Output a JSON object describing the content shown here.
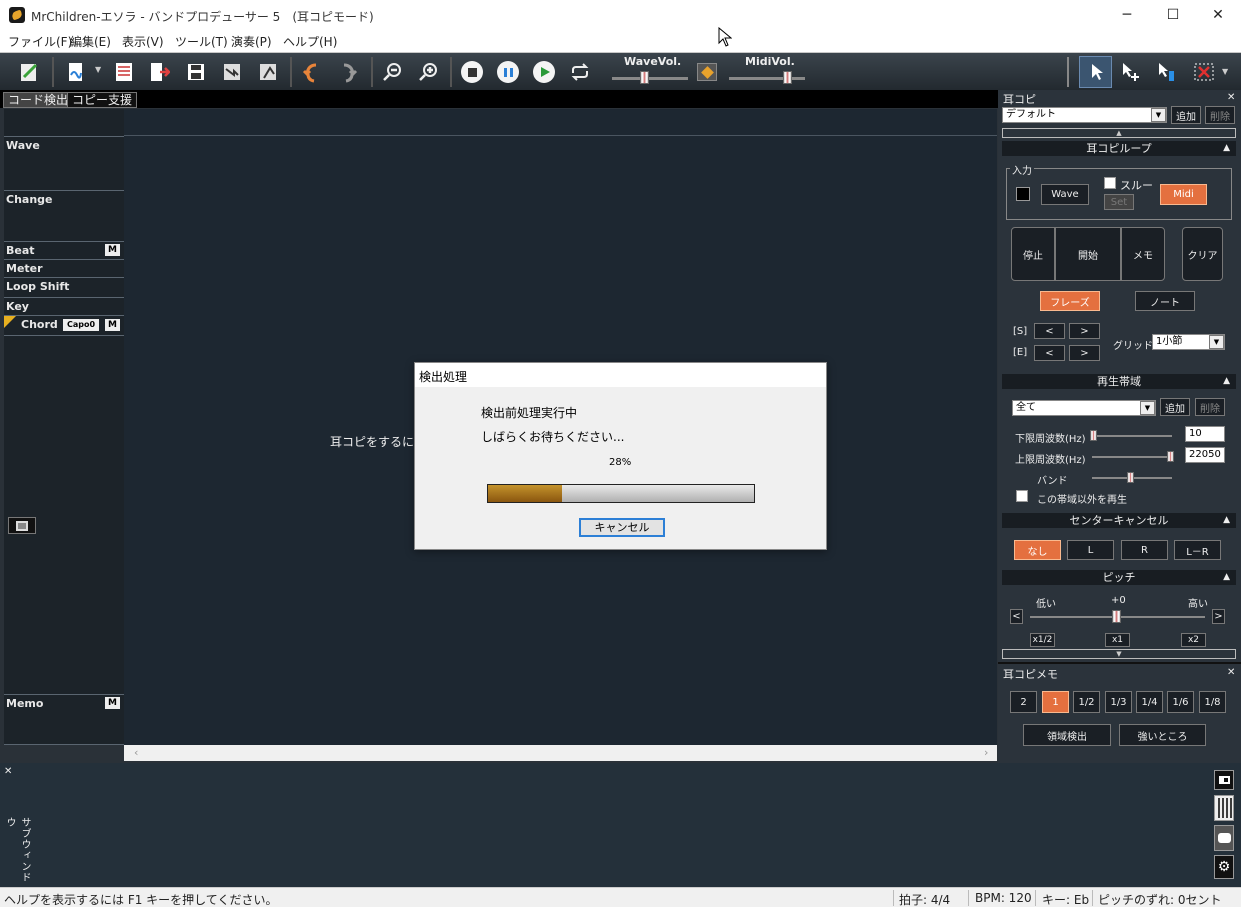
{
  "window": {
    "title": "MrChildren-エソラ - バンドプロデューサー 5　(耳コピモード)"
  },
  "menu": [
    "ファイル(F)",
    "編集(E)",
    "表示(V)",
    "ツール(T)",
    "演奏(P)",
    "ヘルプ(H)"
  ],
  "toolbar": {
    "wave_vol_label": "WaveVol.",
    "midi_vol_label": "MidiVol."
  },
  "tabs": [
    "コード検出",
    "コピー支援"
  ],
  "tracks": {
    "wave": "Wave",
    "change": "Change",
    "beat": "Beat",
    "meter": "Meter",
    "loop_shift": "Loop Shift",
    "key": "Key",
    "chord": "Chord",
    "capo": "Capo0",
    "memo": "Memo",
    "m": "M"
  },
  "canvas": {
    "hint_text": "耳コピをするにはメ"
  },
  "dialog": {
    "title": "検出処理",
    "line1": "検出前処理実行中",
    "line2": "しばらくお待ちください...",
    "percent_text": "28%",
    "progress": 0.28,
    "cancel": "キャンセル"
  },
  "right": {
    "panel_title": "耳コピ",
    "preset_select": "デフォルト",
    "add": "追加",
    "delete": "削除",
    "loop_section": "耳コピループ",
    "input_group": "入力",
    "wave_btn": "Wave",
    "through": "スルー",
    "set": "Set",
    "midi_btn": "Midi",
    "stop": "停止",
    "start": "開始",
    "memo": "メモ",
    "clear": "クリア",
    "phrase": "フレーズ",
    "note": "ノート",
    "s_label": "[S]",
    "e_label": "[E]",
    "lt": "<",
    "gt": ">",
    "grid_label": "グリッド",
    "grid_value": "1小節",
    "band_section": "再生帯域",
    "band_select": "全て",
    "low_freq_label": "下限周波数(Hz)",
    "low_freq_value": "10",
    "high_freq_label": "上限周波数(Hz)",
    "high_freq_value": "22050",
    "band_label": "バンド",
    "play_outside": "この帯域以外を再生",
    "center_cancel_section": "センターキャンセル",
    "cc_options": [
      "なし",
      "L",
      "R",
      "L－R"
    ],
    "pitch_section": "ピッチ",
    "pitch_low": "低い",
    "pitch_mid": "+0",
    "pitch_high": "高い",
    "speed": [
      "x1/2",
      "x1",
      "x2"
    ],
    "memo_panel_title": "耳コピメモ",
    "divisions": [
      "2",
      "1",
      "1/2",
      "1/3",
      "1/4",
      "1/6",
      "1/8"
    ],
    "region_detect": "領域検出",
    "strong_part": "強いところ"
  },
  "subwindow": {
    "label": "サブウィンドウ"
  },
  "status": {
    "help": "ヘルプを表示するには F1 キーを押してください。",
    "beat": "拍子: 4/4",
    "bpm": "BPM: 120",
    "key": "キー: Eb",
    "pitch_offset": "ピッチのずれ: 0セント"
  },
  "colors": {
    "accent_orange": "#e4703f",
    "progress_fill": "#a9721b",
    "focus_blue": "#2c7fd6"
  }
}
